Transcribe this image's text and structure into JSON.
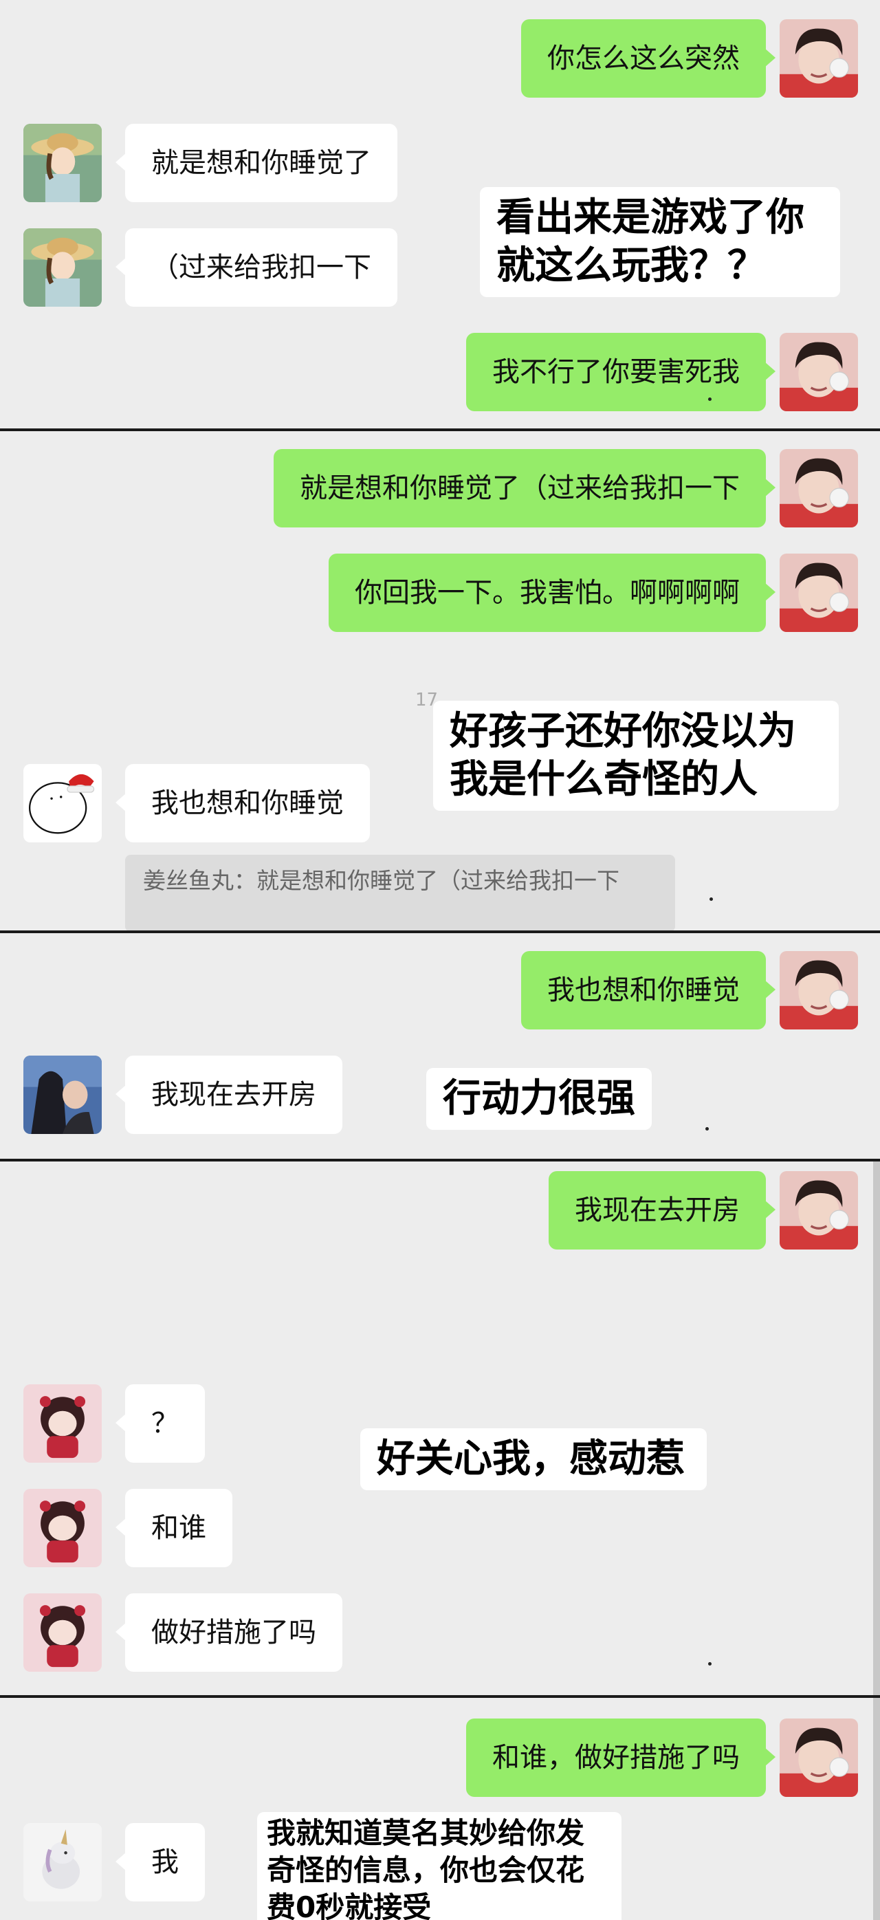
{
  "segments": [
    {
      "messages": [
        {
          "side": "right",
          "text": "你怎么这么突然",
          "avatar": "profile-photo-avatar"
        },
        {
          "side": "left",
          "text": "就是想和你睡觉了",
          "avatar": "anime-girl-hat-avatar"
        },
        {
          "side": "left",
          "text": "（过来给我扣一下",
          "avatar": "anime-girl-hat-avatar"
        },
        {
          "side": "right",
          "text": "我不行了你要害死我",
          "avatar": "profile-photo-avatar"
        }
      ],
      "note": "看出来是游戏了你就这么玩我？？"
    },
    {
      "messages": [
        {
          "side": "right",
          "text": "就是想和你睡觉了（过来给我扣一下",
          "avatar": "profile-photo-avatar"
        },
        {
          "side": "right",
          "text": "你回我一下。我害怕。啊啊啊啊",
          "avatar": "profile-photo-avatar"
        },
        {
          "side": "left",
          "text": "我也想和你睡觉",
          "avatar": "santa-hat-doodle-avatar"
        }
      ],
      "time": "17",
      "quote": "姜丝鱼丸：就是想和你睡觉了（过来给我扣一下",
      "note": "好孩子还好你没以为我是什么奇怪的人"
    },
    {
      "messages": [
        {
          "side": "right",
          "text": "我也想和你睡觉",
          "avatar": "profile-photo-avatar"
        },
        {
          "side": "left",
          "text": "我现在去开房",
          "avatar": "photo-avatar"
        }
      ],
      "note": "行动力很强"
    },
    {
      "messages": [
        {
          "side": "right",
          "text": "我现在去开房",
          "avatar": "profile-photo-avatar"
        },
        {
          "side": "left",
          "text": "？",
          "avatar": "chibi-character-avatar"
        },
        {
          "side": "left",
          "text": "和谁",
          "avatar": "chibi-character-avatar"
        },
        {
          "side": "left",
          "text": "做好措施了吗",
          "avatar": "chibi-character-avatar"
        }
      ],
      "note": "好关心我，感动惹"
    },
    {
      "messages": [
        {
          "side": "right",
          "text": "和谁，做好措施了吗",
          "avatar": "profile-photo-avatar"
        },
        {
          "side": "left",
          "text": "我",
          "avatar": "unicorn-avatar"
        }
      ],
      "note": "我就知道莫名其妙给你发奇怪的信息，你也会仅花费0秒就接受"
    }
  ],
  "colors": {
    "background": "#ededed",
    "sent_bubble": "#95ec69",
    "received_bubble": "#ffffff",
    "divider": "#1a1a1a"
  }
}
